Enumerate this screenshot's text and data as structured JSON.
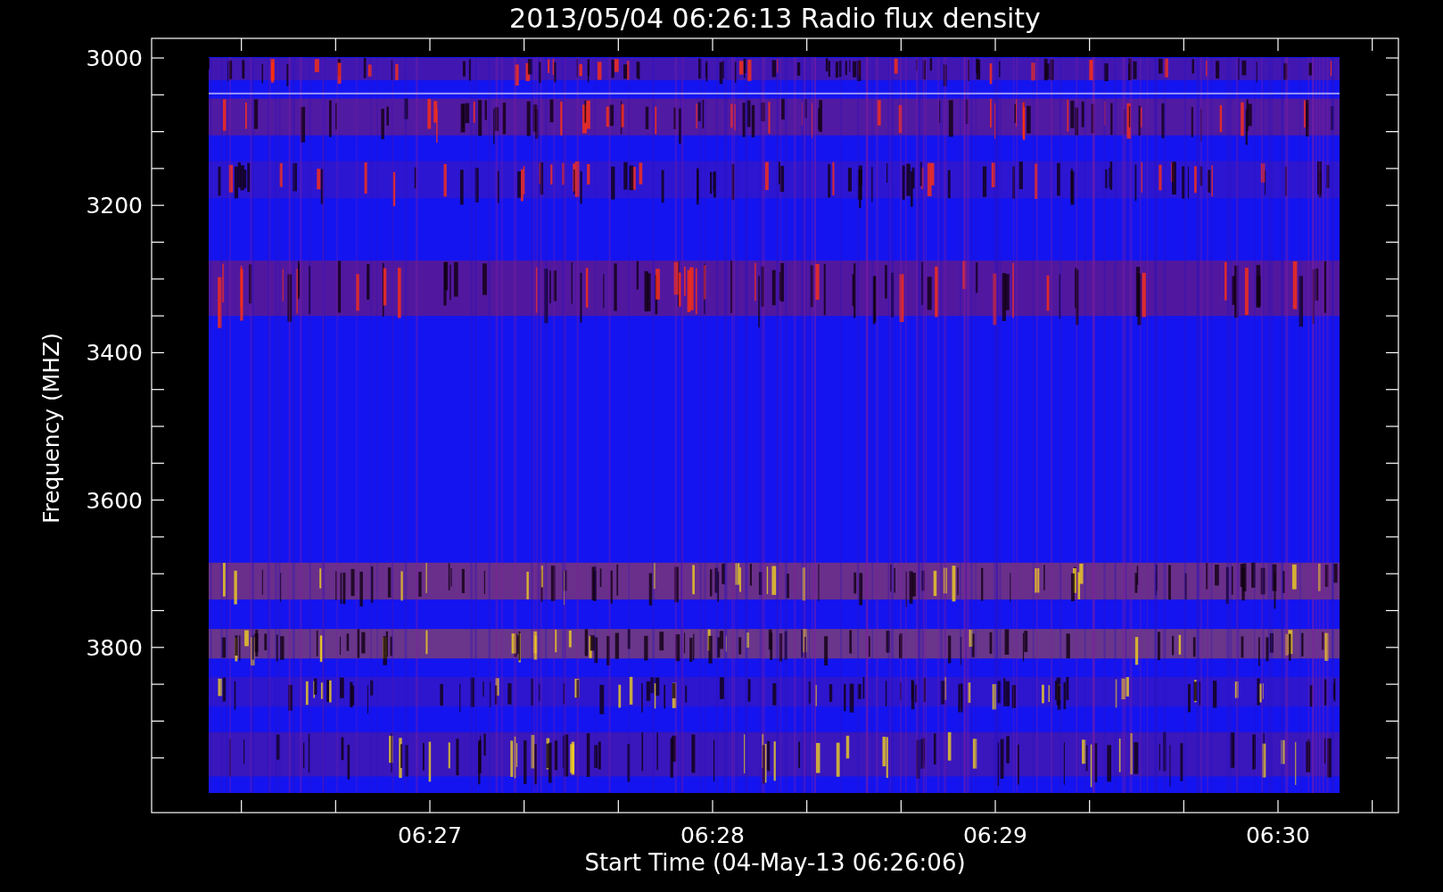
{
  "title": "2013/05/04 06:26:13 Radio flux density",
  "y_axis": {
    "label": "Frequency (MHZ)",
    "ticks": [
      "3000",
      "3200",
      "3400",
      "3600",
      "3800"
    ]
  },
  "x_axis": {
    "label": "Start Time (04-May-13 06:26:06)",
    "ticks": [
      "06:27",
      "06:28",
      "06:29",
      "06:30"
    ]
  }
}
